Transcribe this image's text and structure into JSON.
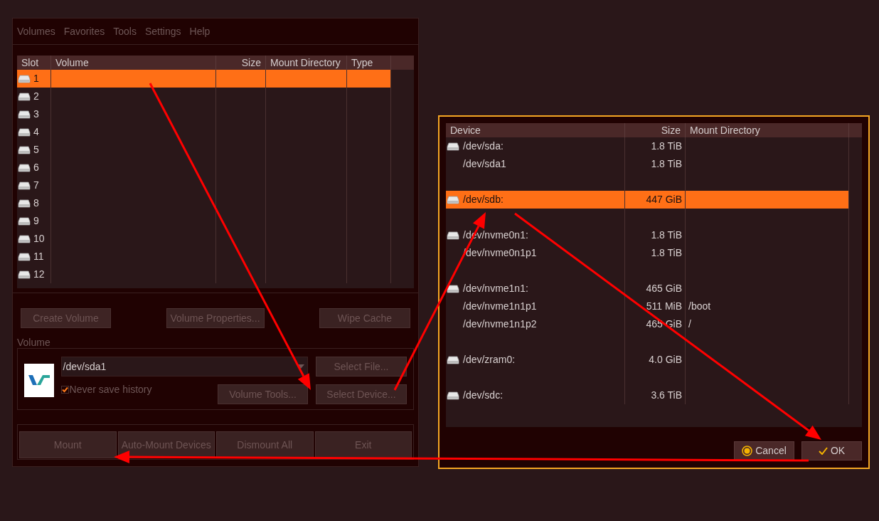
{
  "main_window": {
    "menu": [
      "Volumes",
      "Favorites",
      "Tools",
      "Settings",
      "Help"
    ],
    "slots_table": {
      "columns": [
        "Slot",
        "Volume",
        "Size",
        "Mount Directory",
        "Type"
      ],
      "rows": [
        {
          "slot": "1",
          "selected": true
        },
        {
          "slot": "2",
          "selected": false
        },
        {
          "slot": "3",
          "selected": false
        },
        {
          "slot": "4",
          "selected": false
        },
        {
          "slot": "5",
          "selected": false
        },
        {
          "slot": "6",
          "selected": false
        },
        {
          "slot": "7",
          "selected": false
        },
        {
          "slot": "8",
          "selected": false
        },
        {
          "slot": "9",
          "selected": false
        },
        {
          "slot": "10",
          "selected": false
        },
        {
          "slot": "11",
          "selected": false
        },
        {
          "slot": "12",
          "selected": false
        }
      ]
    },
    "top_buttons": [
      "Create Volume",
      "Volume Properties...",
      "Wipe Cache"
    ],
    "volume_group": {
      "label": "Volume",
      "path": "/dev/sda1",
      "never_save_history": {
        "label": "Never save history",
        "checked": true
      },
      "select_file": "Select File...",
      "volume_tools": "Volume Tools...",
      "select_device": "Select Device..."
    },
    "bottom_buttons": [
      "Mount",
      "Auto-Mount Devices",
      "Dismount All",
      "Exit"
    ]
  },
  "device_dialog": {
    "columns": [
      "Device",
      "Size",
      "Mount Directory"
    ],
    "rows": [
      {
        "kind": "disk",
        "device": "/dev/sda:",
        "size": "1.8 TiB",
        "selected": false
      },
      {
        "kind": "partition",
        "device": "/dev/sda1",
        "size": "1.8 TiB",
        "selected": false
      },
      {
        "kind": "spacer"
      },
      {
        "kind": "disk",
        "device": "/dev/sdb:",
        "size": "447 GiB",
        "selected": true
      },
      {
        "kind": "spacer"
      },
      {
        "kind": "disk",
        "device": "/dev/nvme0n1:",
        "size": "1.8 TiB",
        "selected": false
      },
      {
        "kind": "partition",
        "device": "/dev/nvme0n1p1",
        "size": "1.8 TiB",
        "selected": false
      },
      {
        "kind": "spacer"
      },
      {
        "kind": "disk",
        "device": "/dev/nvme1n1:",
        "size": "465 GiB",
        "selected": false
      },
      {
        "kind": "partition",
        "device": "/dev/nvme1n1p1",
        "size": "511 MiB",
        "mount": "/boot",
        "selected": false
      },
      {
        "kind": "partition",
        "device": "/dev/nvme1n1p2",
        "size": "465 GiB",
        "mount": "/",
        "selected": false
      },
      {
        "kind": "spacer"
      },
      {
        "kind": "disk",
        "device": "/dev/zram0:",
        "size": "4.0 GiB",
        "selected": false
      },
      {
        "kind": "spacer"
      },
      {
        "kind": "disk",
        "device": "/dev/sdc:",
        "size": "3.6 TiB",
        "selected": false
      }
    ],
    "buttons": [
      {
        "kind": "cancel",
        "label": "Cancel"
      },
      {
        "kind": "ok",
        "label": "OK"
      }
    ]
  }
}
